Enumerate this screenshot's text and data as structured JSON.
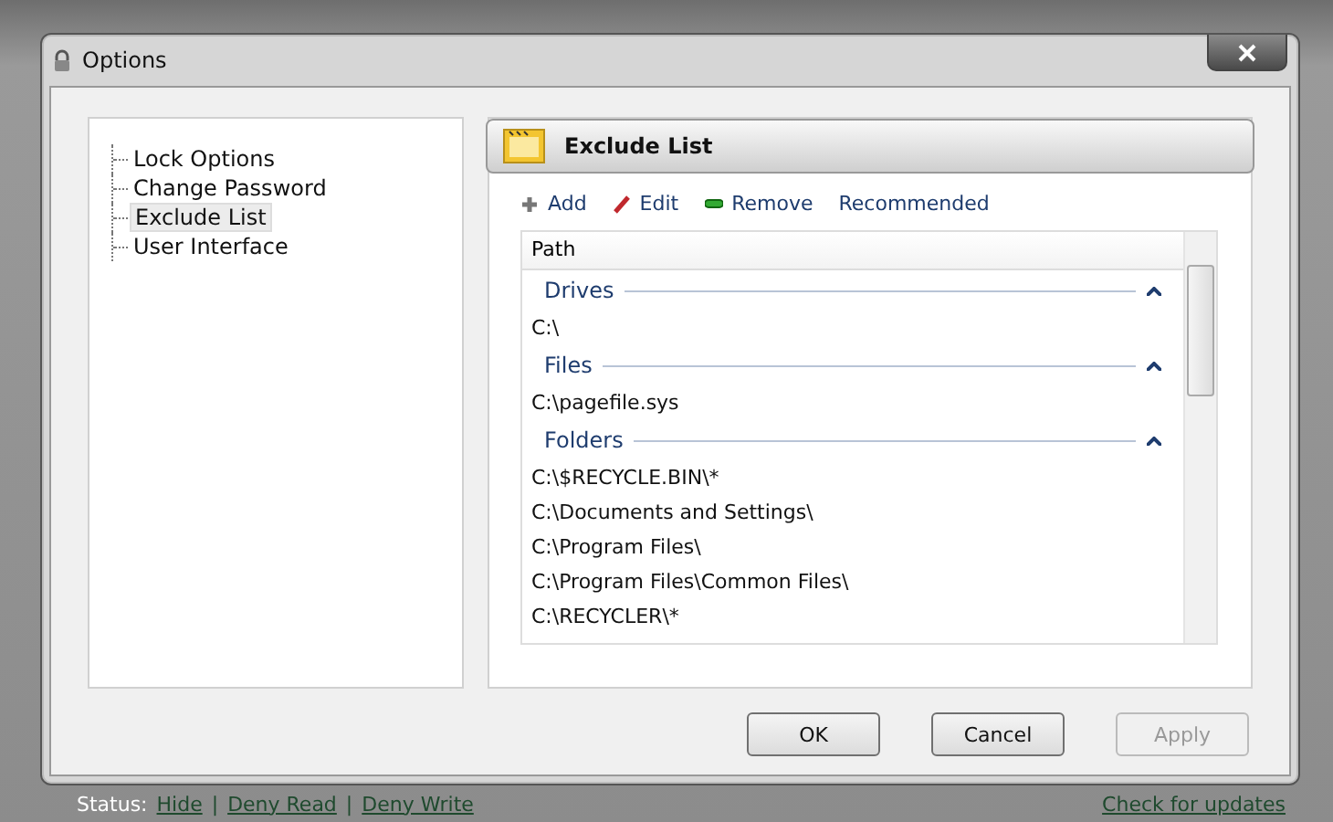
{
  "window": {
    "title": "Options"
  },
  "tree": [
    {
      "label": "Lock Options",
      "selected": false
    },
    {
      "label": "Change Password",
      "selected": false
    },
    {
      "label": "Exclude List",
      "selected": true
    },
    {
      "label": "User Interface",
      "selected": false
    }
  ],
  "panel": {
    "title": "Exclude List",
    "actions": [
      {
        "kind": "add",
        "label": "Add"
      },
      {
        "kind": "edit",
        "label": "Edit"
      },
      {
        "kind": "remove",
        "label": "Remove"
      },
      {
        "kind": "plain",
        "label": "Recommended"
      }
    ],
    "list": {
      "column": "Path",
      "groups": [
        {
          "name": "Drives",
          "expanded": true,
          "items": [
            "C:\\"
          ]
        },
        {
          "name": "Files",
          "expanded": true,
          "items": [
            "C:\\pagefile.sys"
          ]
        },
        {
          "name": "Folders",
          "expanded": true,
          "items": [
            "C:\\$RECYCLE.BIN\\*",
            "C:\\Documents and Settings\\",
            "C:\\Program Files\\",
            "C:\\Program Files\\Common Files\\",
            "C:\\RECYCLER\\*"
          ]
        }
      ]
    }
  },
  "buttons": [
    {
      "label": "OK",
      "disabled": false
    },
    {
      "label": "Cancel",
      "disabled": false
    },
    {
      "label": "Apply",
      "disabled": true
    }
  ],
  "status_bar": {
    "label": "Status:",
    "links": [
      "Hide",
      "Deny Read",
      "Deny Write"
    ],
    "separator": "|",
    "update_link": "Check for updates"
  }
}
